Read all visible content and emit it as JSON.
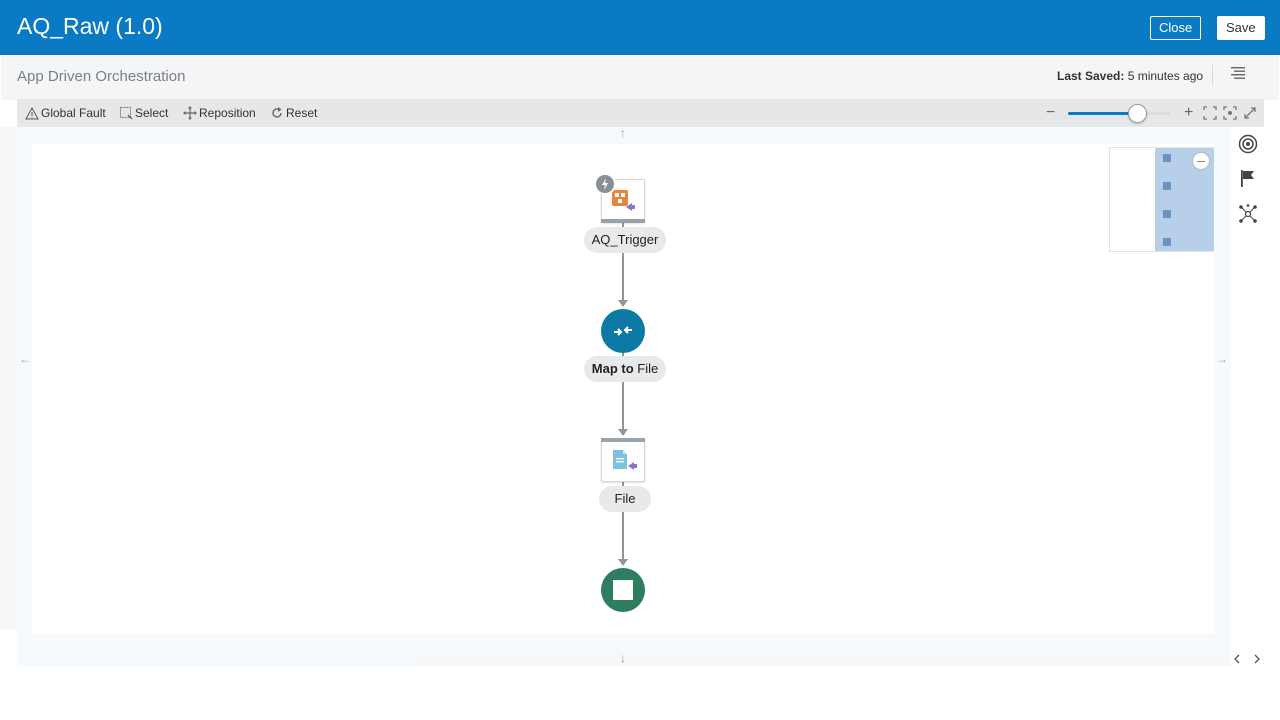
{
  "header": {
    "title": "AQ_Raw (1.0)",
    "close_label": "Close",
    "save_label": "Save"
  },
  "subheader": {
    "title": "App Driven Orchestration",
    "last_saved_label": "Last Saved:",
    "last_saved_value": " 5 minutes ago"
  },
  "toolbar": {
    "global_fault": "Global Fault",
    "select": "Select",
    "reposition": "Reposition",
    "reset": "Reset"
  },
  "zoom": {
    "minus": "−",
    "plus": "+",
    "level_fraction": 0.69
  },
  "canvas": {
    "hint_up": "↑",
    "hint_down": "↓",
    "hint_left": "←",
    "hint_right": "→"
  },
  "nodes": [
    {
      "label": "AQ_Trigger",
      "kind": "trigger"
    },
    {
      "label_bold": "Map to",
      "label_rest": " File",
      "kind": "map"
    },
    {
      "label": "File",
      "kind": "invoke"
    },
    {
      "kind": "end"
    }
  ],
  "colors": {
    "header": "#0a7ac5",
    "map_node": "#0d7aa6",
    "end_node": "#2e7d5f",
    "connector": "#8f979d"
  }
}
